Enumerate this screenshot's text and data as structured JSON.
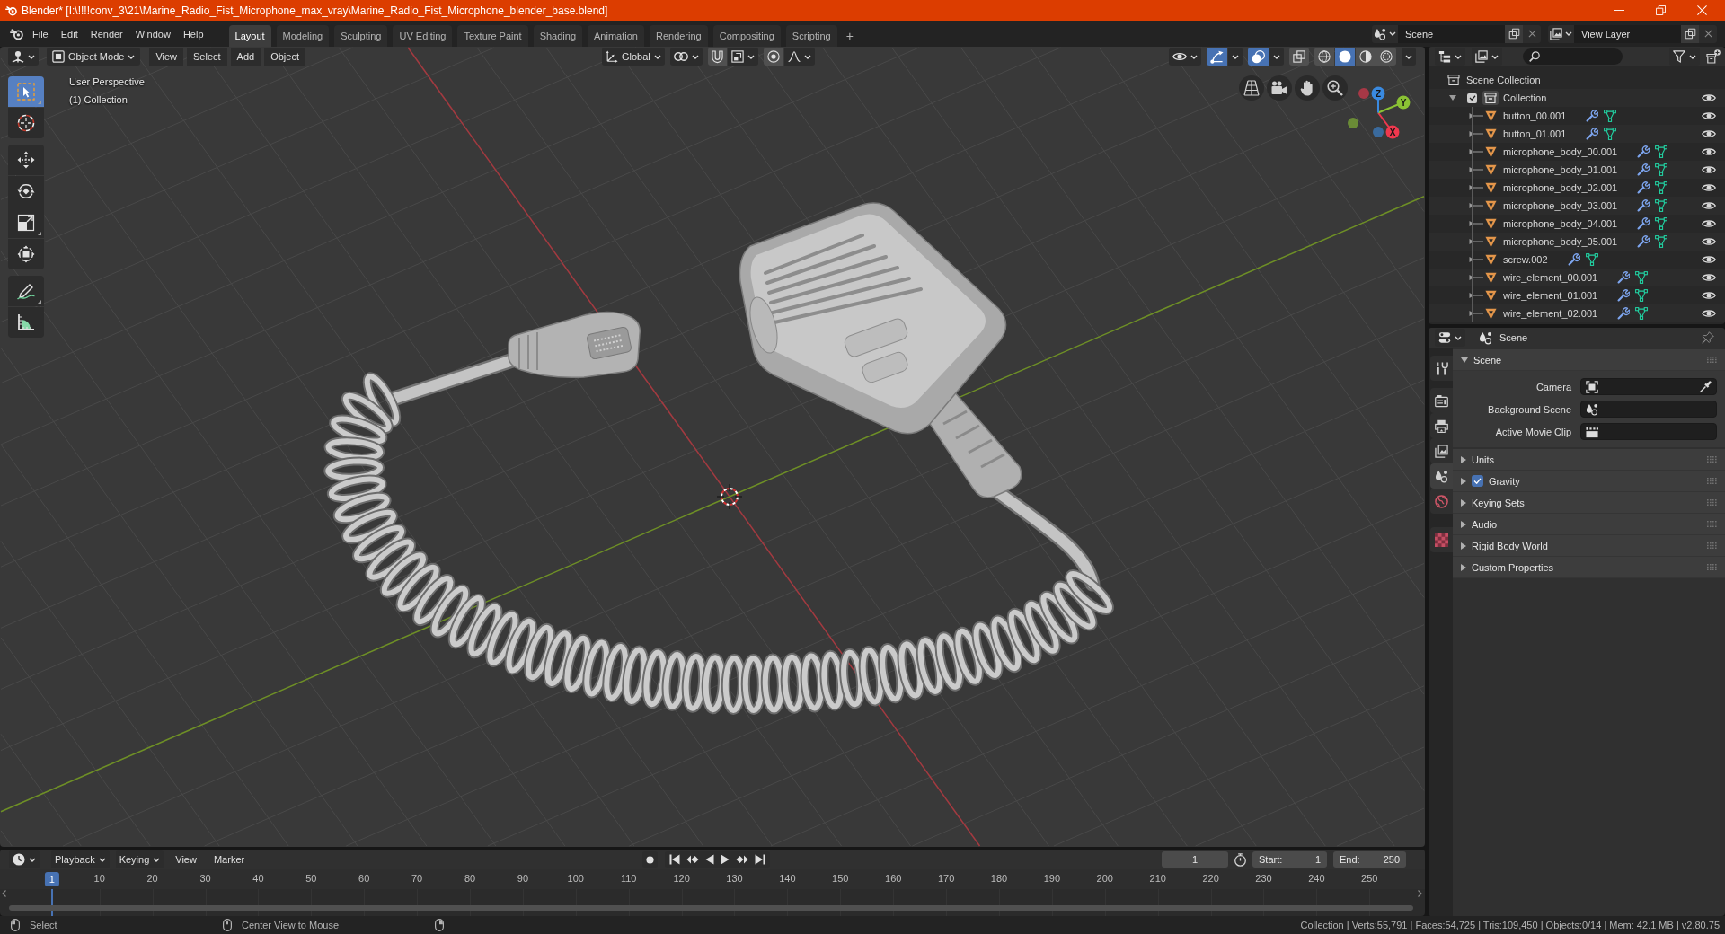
{
  "window": {
    "title": "Blender* [I:\\!!!!conv_3\\21\\Marine_Radio_Fist_Microphone_max_vray\\Marine_Radio_Fist_Microphone_blender_base.blend]"
  },
  "top_bar": {
    "menus": [
      "File",
      "Edit",
      "Render",
      "Window",
      "Help"
    ],
    "workspaces": [
      {
        "label": "Layout",
        "selected": true
      },
      {
        "label": "Modeling",
        "selected": false
      },
      {
        "label": "Sculpting",
        "selected": false
      },
      {
        "label": "UV Editing",
        "selected": false
      },
      {
        "label": "Texture Paint",
        "selected": false
      },
      {
        "label": "Shading",
        "selected": false
      },
      {
        "label": "Animation",
        "selected": false
      },
      {
        "label": "Rendering",
        "selected": false
      },
      {
        "label": "Compositing",
        "selected": false
      },
      {
        "label": "Scripting",
        "selected": false
      }
    ],
    "add_workspace": "+",
    "scene": "Scene",
    "view_layer": "View Layer"
  },
  "viewport": {
    "mode": "Object Mode",
    "menus": [
      "View",
      "Select",
      "Add",
      "Object"
    ],
    "orientation": "Global",
    "snap": {
      "on": false
    },
    "proportional_editing": {
      "on": false
    },
    "gizmos": {
      "on": true
    },
    "overlays": {
      "on": true
    },
    "xray": {
      "on": false
    },
    "shading": [
      {
        "kind": "wireframe",
        "selected": false
      },
      {
        "kind": "solid",
        "selected": true
      },
      {
        "kind": "material",
        "selected": false
      },
      {
        "kind": "rendered",
        "selected": false
      }
    ],
    "info": [
      "User Perspective",
      "(1) Collection"
    ],
    "toolbar": [
      {
        "tools": [
          {
            "kind": "select_box",
            "selected": true,
            "variants": true
          },
          {
            "kind": "cursor",
            "selected": false,
            "variants": false
          }
        ]
      },
      {
        "tools": [
          {
            "kind": "move",
            "selected": false,
            "variants": false
          },
          {
            "kind": "rotate",
            "selected": false,
            "variants": false
          },
          {
            "kind": "scale",
            "selected": false,
            "variants": true
          },
          {
            "kind": "transform",
            "selected": false,
            "variants": false
          }
        ]
      },
      {
        "tools": [
          {
            "kind": "annotate",
            "selected": false,
            "variants": true
          },
          {
            "kind": "measure",
            "selected": false,
            "variants": false
          }
        ]
      }
    ],
    "navigation": [
      {
        "kind": "perspective"
      },
      {
        "kind": "camera"
      },
      {
        "kind": "pan"
      },
      {
        "kind": "zoom"
      }
    ],
    "gizmo_axes": [
      {
        "label": "X",
        "color": "#f0384e"
      },
      {
        "label": "Y",
        "color": "#8ac234"
      },
      {
        "label": "Z",
        "color": "#3a8ae0"
      }
    ]
  },
  "outliner": {
    "tree": [
      {
        "kind": "scene_collection",
        "label": "Scene Collection",
        "children": [
          {
            "kind": "collection",
            "label": "Collection",
            "expanded": true,
            "checked": true,
            "visible": true,
            "children": [
              {
                "kind": "mesh_object",
                "label": "button_00.001",
                "expanded": false,
                "visible": true
              },
              {
                "kind": "mesh_object",
                "label": "button_01.001",
                "expanded": false,
                "visible": true
              },
              {
                "kind": "mesh_object",
                "label": "microphone_body_00.001",
                "expanded": false,
                "visible": true
              },
              {
                "kind": "mesh_object",
                "label": "microphone_body_01.001",
                "expanded": false,
                "visible": true
              },
              {
                "kind": "mesh_object",
                "label": "microphone_body_02.001",
                "expanded": false,
                "visible": true
              },
              {
                "kind": "mesh_object",
                "label": "microphone_body_03.001",
                "expanded": false,
                "visible": true
              },
              {
                "kind": "mesh_object",
                "label": "microphone_body_04.001",
                "expanded": false,
                "visible": true
              },
              {
                "kind": "mesh_object",
                "label": "microphone_body_05.001",
                "expanded": false,
                "visible": true
              },
              {
                "kind": "mesh_object",
                "label": "screw.002",
                "expanded": false,
                "visible": true
              },
              {
                "kind": "mesh_object",
                "label": "wire_element_00.001",
                "expanded": false,
                "visible": true
              },
              {
                "kind": "mesh_object",
                "label": "wire_element_01.001",
                "expanded": false,
                "visible": true
              },
              {
                "kind": "mesh_object",
                "label": "wire_element_02.001",
                "expanded": false,
                "visible": true
              }
            ]
          }
        ]
      }
    ]
  },
  "properties": {
    "title": "Scene",
    "tab_groups": [
      {
        "tabs": [
          {
            "kind": "tool",
            "selected": false
          }
        ]
      },
      {
        "tabs": [
          {
            "kind": "render",
            "selected": false
          },
          {
            "kind": "output",
            "selected": false
          },
          {
            "kind": "view_layer",
            "selected": false
          },
          {
            "kind": "scene",
            "selected": true
          },
          {
            "kind": "world",
            "selected": false
          }
        ]
      },
      {
        "tabs": [
          {
            "kind": "texture",
            "selected": false
          }
        ]
      }
    ],
    "panels": [
      {
        "kind": "plain",
        "title": "Scene",
        "expanded": true,
        "fields": [
          {
            "label": "Camera",
            "kind": "camera"
          },
          {
            "label": "Background Scene",
            "kind": "scene"
          },
          {
            "label": "Active Movie Clip",
            "kind": "clip"
          }
        ]
      },
      {
        "kind": "plain",
        "title": "Units",
        "expanded": false
      },
      {
        "kind": "toggle",
        "title": "Gravity",
        "expanded": false,
        "checked": true
      },
      {
        "kind": "plain",
        "title": "Keying Sets",
        "expanded": false
      },
      {
        "kind": "plain",
        "title": "Audio",
        "expanded": false
      },
      {
        "kind": "plain",
        "title": "Rigid Body World",
        "expanded": false
      },
      {
        "kind": "plain",
        "title": "Custom Properties",
        "expanded": false
      }
    ]
  },
  "timeline": {
    "dropdowns": [
      "Playback",
      "Keying"
    ],
    "menus": [
      "View",
      "Marker"
    ],
    "auto_keying": {
      "on": false
    },
    "transport": [
      {
        "kind": "jump_start"
      },
      {
        "kind": "prev_keyframe"
      },
      {
        "kind": "play_reverse"
      },
      {
        "kind": "play"
      },
      {
        "kind": "next_keyframe"
      },
      {
        "kind": "jump_end"
      }
    ],
    "current_frame": "1",
    "start": {
      "label": "Start:",
      "value": "1"
    },
    "end": {
      "label": "End:",
      "value": "250"
    },
    "playhead": "1",
    "ruler": [
      "10",
      "20",
      "30",
      "40",
      "50",
      "60",
      "70",
      "80",
      "90",
      "100",
      "110",
      "120",
      "130",
      "140",
      "150",
      "160",
      "170",
      "180",
      "190",
      "200",
      "210",
      "220",
      "230",
      "240",
      "250"
    ]
  },
  "status_bar": {
    "hints": [
      {
        "kind": "mouse_left",
        "label": "Select"
      },
      {
        "kind": "mouse_middle",
        "label": "Center View to Mouse"
      },
      {
        "kind": "mouse_right"
      }
    ],
    "stats": "Collection | Verts:55,791 | Faces:54,725 | Tris:109,450 | Objects:0/14 | Mem: 42.1 MB | v2.80.75"
  }
}
